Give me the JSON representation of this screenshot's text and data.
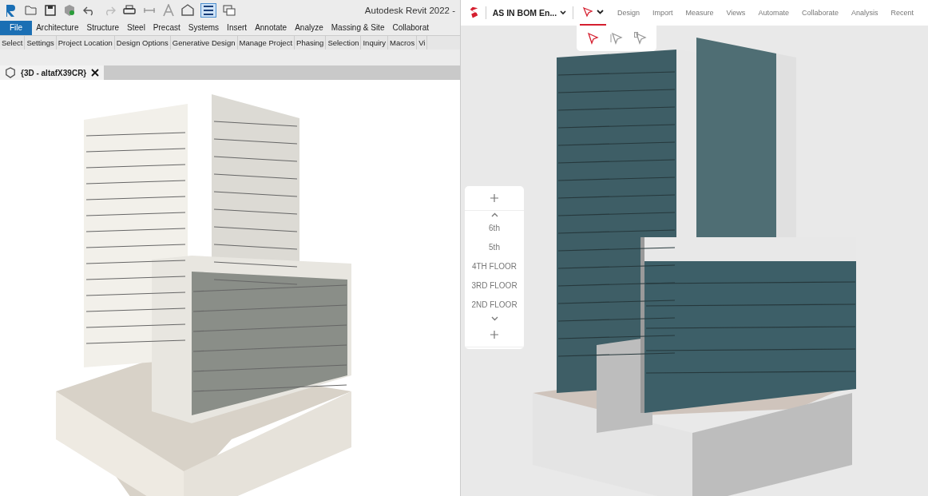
{
  "revit": {
    "title": "Autodesk Revit 2022 -",
    "ribbon_tabs": [
      {
        "label": "File",
        "selected": true
      },
      {
        "label": "Architecture",
        "selected": false
      },
      {
        "label": "Structure",
        "selected": false
      },
      {
        "label": "Steel",
        "selected": false
      },
      {
        "label": "Precast",
        "selected": false
      },
      {
        "label": "Systems",
        "selected": false
      },
      {
        "label": "Insert",
        "selected": false
      },
      {
        "label": "Annotate",
        "selected": false
      },
      {
        "label": "Analyze",
        "selected": false
      },
      {
        "label": "Massing & Site",
        "selected": false
      },
      {
        "label": "Collaborat",
        "selected": false
      }
    ],
    "panels": [
      "Select",
      "Settings",
      "Project Location",
      "Design Options",
      "Generative Design",
      "Manage Project",
      "Phasing",
      "Selection",
      "Inquiry",
      "Macros",
      "Vi"
    ],
    "view_tab": "{3D - altafX39CR}"
  },
  "web_app": {
    "project": "AS IN BOM En...",
    "menu": [
      "Design",
      "Import",
      "Measure",
      "Views",
      "Automate",
      "Collaborate",
      "Analysis",
      "Recent"
    ],
    "select_tools": [
      {
        "selected": true
      },
      {
        "selected": false
      },
      {
        "selected": false
      }
    ],
    "floors": [
      "6th",
      "5th",
      "4TH FLOOR",
      "3RD FLOOR",
      "2ND FLOOR"
    ]
  }
}
